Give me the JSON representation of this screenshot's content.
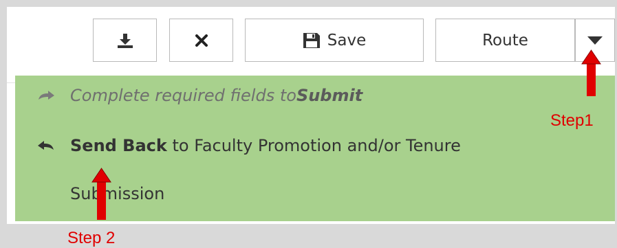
{
  "toolbar": {
    "download_icon": "download-icon",
    "close_icon": "close-icon",
    "save_icon": "floppy-disk-icon",
    "save_label": "Save",
    "route_label": "Route",
    "caret_icon": "caret-down-icon"
  },
  "route_menu": {
    "items": [
      {
        "icon": "arrow-right-icon",
        "prefix": "Complete required fields to ",
        "bold": "Submit",
        "suffix": "",
        "state": "disabled"
      },
      {
        "icon": "arrow-left-icon",
        "prefix": "",
        "bold": "Send Back",
        "suffix": " to Faculty Promotion and/or Tenure",
        "continuation": "Submission",
        "state": "enabled"
      }
    ]
  },
  "annotations": {
    "step1": "Step1",
    "step2": "Step 2"
  },
  "colors": {
    "menu_background": "#a8d18d",
    "annotation_red": "#e00000",
    "page_background": "#d9d9d9"
  }
}
